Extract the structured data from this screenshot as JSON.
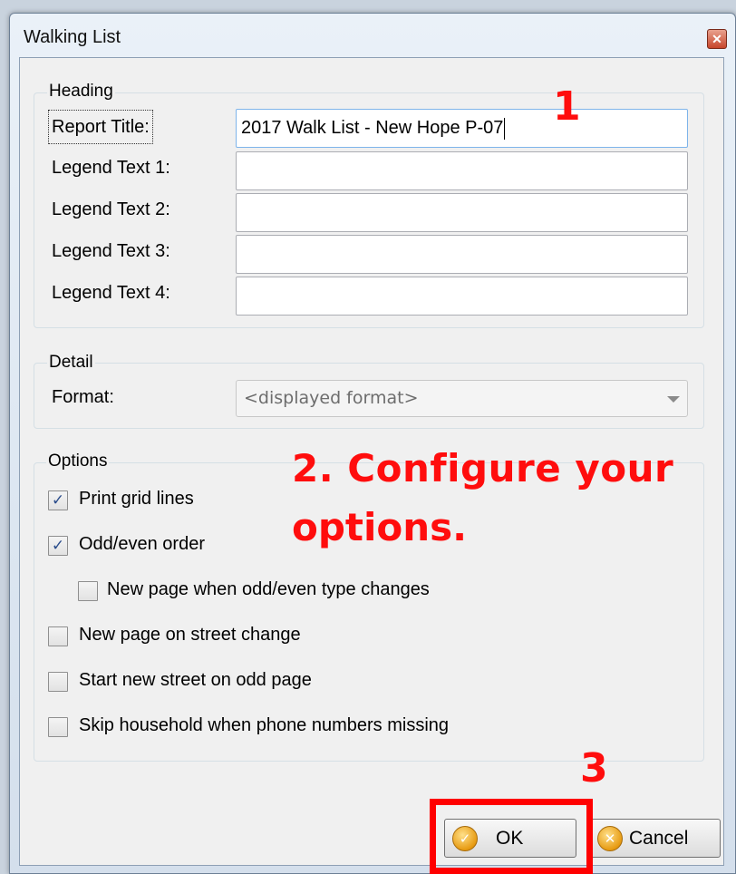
{
  "window": {
    "title": "Walking List",
    "close_glyph": "✕"
  },
  "heading_group": {
    "label": "Heading",
    "fields": [
      {
        "label": "Report Title:",
        "value": "2017 Walk List - New Hope P-07"
      },
      {
        "label": "Legend Text 1:",
        "value": ""
      },
      {
        "label": "Legend Text 2:",
        "value": ""
      },
      {
        "label": "Legend Text 3:",
        "value": ""
      },
      {
        "label": "Legend Text 4:",
        "value": ""
      }
    ]
  },
  "detail_group": {
    "label": "Detail",
    "format_label": "Format:",
    "format_value": "<displayed format>"
  },
  "options_group": {
    "label": "Options",
    "options": [
      {
        "label": "Print grid lines",
        "checked": true
      },
      {
        "label": "Odd/even order",
        "checked": true
      },
      {
        "label": "New page when odd/even type changes",
        "checked": false
      },
      {
        "label": "New page on street change",
        "checked": false
      },
      {
        "label": "Start new street on odd page",
        "checked": false
      },
      {
        "label": "Skip household when phone numbers missing",
        "checked": false
      }
    ]
  },
  "buttons": {
    "ok": "OK",
    "cancel": "Cancel"
  },
  "annotations": {
    "step1": "1",
    "step2_line1": "2. Configure your",
    "step2_line2": "options.",
    "step3": "3",
    "color": "#ff0d0d"
  },
  "check_glyph": "✓",
  "icons": {
    "ok": "check-circle-icon",
    "cancel": "x-circle-icon"
  }
}
